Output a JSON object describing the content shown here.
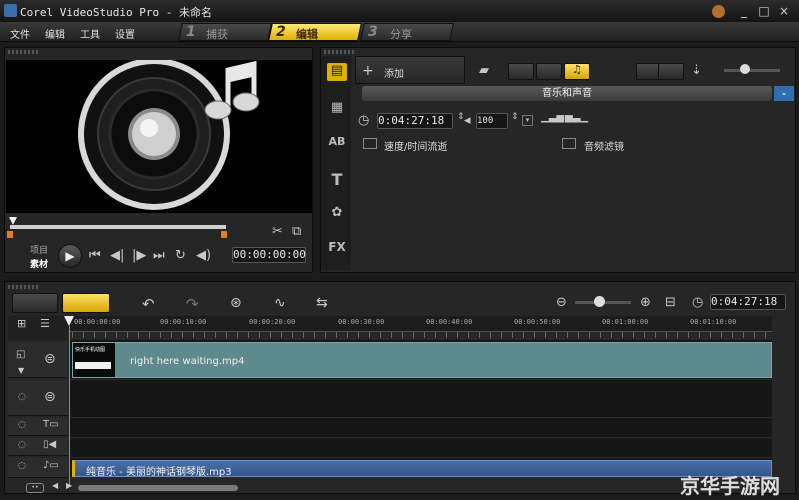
{
  "window": {
    "title": "Corel VideoStudio Pro - 未命名"
  },
  "menu": [
    "文件",
    "编辑",
    "工具",
    "设置"
  ],
  "steps": [
    {
      "num": "1",
      "label": "捕获"
    },
    {
      "num": "2",
      "label": "编辑"
    },
    {
      "num": "3",
      "label": "分享"
    }
  ],
  "preview": {
    "mode_project": "项目",
    "mode_clip": "素材",
    "timecode": "00:00:00:00"
  },
  "library": {
    "add_label": "添加",
    "panel_title": "音乐和声音",
    "duration": "0:04:27:18",
    "volume": "100",
    "speed_label": "速度/时间流逝",
    "filter_label": "音频滤镜"
  },
  "timeline": {
    "duration": "0:04:27:18",
    "ticks": [
      "00:00:00:00",
      "00:00:10:00",
      "00:00:20:00",
      "00:00:30:00",
      "00:00:40:00",
      "00:00:50:00",
      "00:01:00:00",
      "00:01:10:00"
    ],
    "video_clip": "right here waiting.mp4",
    "thumb_caption": "快乐手机动图",
    "music_clip": "纯音乐 - 美丽的神话钢琴版.mp3"
  },
  "watermark": "京华手游网"
}
